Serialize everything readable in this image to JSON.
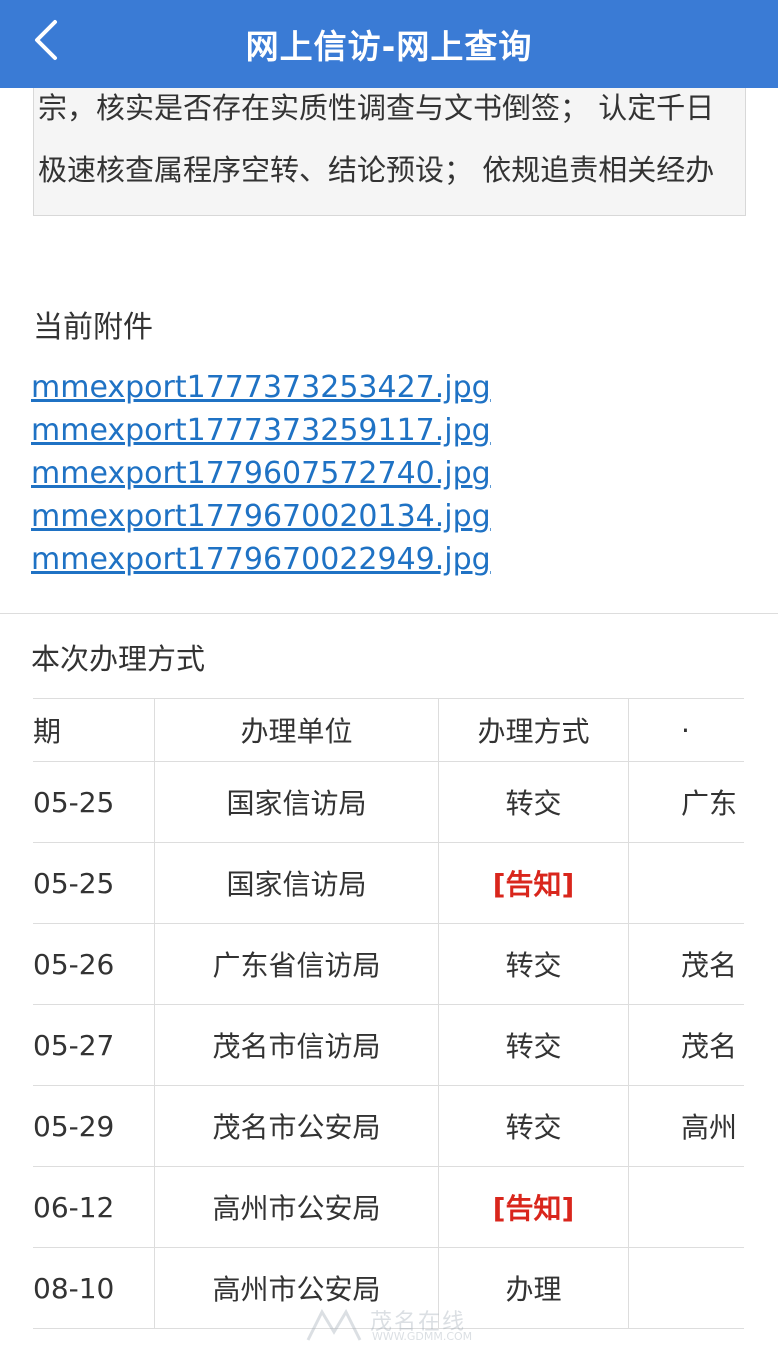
{
  "header": {
    "title": "网上信访-网上查询"
  },
  "content": {
    "text": "宗，核实是否存在实质性调查与文书倒签； 认定千日极速核查属程序空转、结论预设； 依规追责相关经办人员； 申请高州市公安局整体回避，由茂名市公安局"
  },
  "attachments": {
    "title": "当前附件",
    "files": [
      "mmexport1777373253427.jpg",
      "mmexport1777373259117.jpg",
      "mmexport1779607572740.jpg",
      "mmexport1779670020134.jpg",
      "mmexport1779670022949.jpg"
    ]
  },
  "handling": {
    "title": "本次办理方式",
    "headers": [
      "期",
      "办理单位",
      "办理方式",
      "·"
    ],
    "rows": [
      {
        "date": "05-25",
        "unit": "国家信访局",
        "mode": "转交",
        "next": "广东"
      },
      {
        "date": "05-25",
        "unit": "国家信访局",
        "mode": "[告知]",
        "next": ""
      },
      {
        "date": "05-26",
        "unit": "广东省信访局",
        "mode": "转交",
        "next": "茂名"
      },
      {
        "date": "05-27",
        "unit": "茂名市信访局",
        "mode": "转交",
        "next": "茂名"
      },
      {
        "date": "05-29",
        "unit": "茂名市公安局",
        "mode": "转交",
        "next": "高州"
      },
      {
        "date": "06-12",
        "unit": "高州市公安局",
        "mode": "[告知]",
        "next": ""
      },
      {
        "date": "08-10",
        "unit": "高州市公安局",
        "mode": "办理",
        "next": ""
      }
    ]
  },
  "watermark": {
    "name": "茂名在线",
    "url": "WWW.GDMM.COM"
  },
  "colors": {
    "header_bg": "#3a7bd5",
    "link": "#1f72c4",
    "notice": "#d9261c"
  },
  "icons": {
    "back": "chevron-left-icon"
  }
}
